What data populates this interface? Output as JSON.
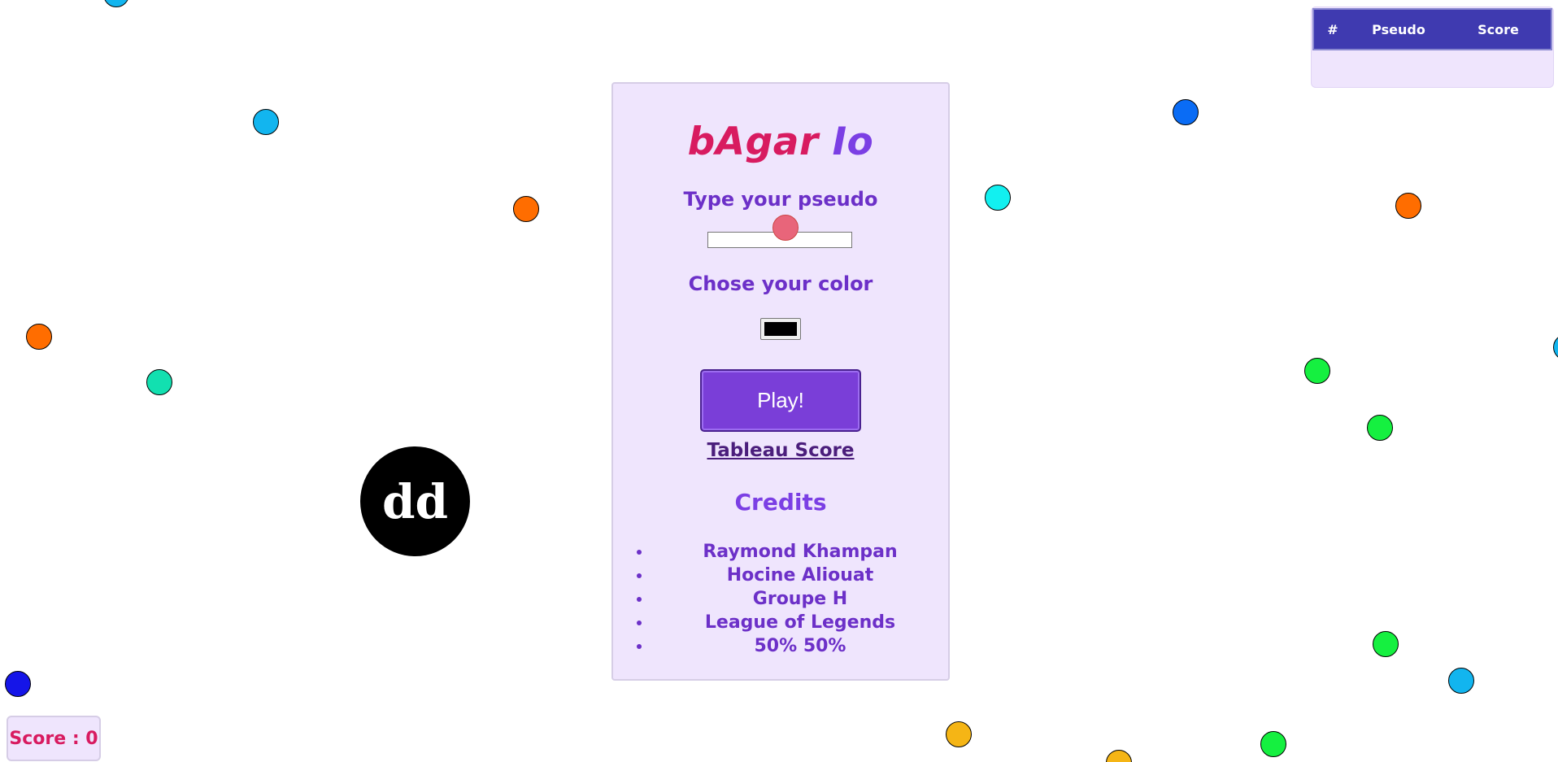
{
  "game": {
    "title_part1": "bAgar",
    "title_part2": " Io",
    "player_name": "dd"
  },
  "menu": {
    "pseudo_label": "Type your pseudo",
    "pseudo_value": "",
    "color_label": "Chose your color",
    "color_value": "#000000",
    "play_label": "Play!",
    "score_link_label": "Tableau Score",
    "credits_title": "Credits",
    "credits": [
      "Raymond Khampan",
      "Hocine Aliouat",
      "Groupe H",
      "League of Legends",
      "50% 50%"
    ]
  },
  "leaderboard": {
    "col_rank": "#",
    "col_pseudo": "Pseudo",
    "col_score": "Score"
  },
  "hud": {
    "score_text": "Score : 0"
  },
  "food_colors": {
    "sky_blue": "#12b5ef",
    "orange": "#ff6d00",
    "teal": "#12e0b0",
    "cyan": "#12f0f0",
    "blue": "#0a6cf5",
    "green": "#15f040",
    "dark_blue": "#1515e8",
    "yellow": "#f5b515",
    "pink": "#e8657a"
  }
}
